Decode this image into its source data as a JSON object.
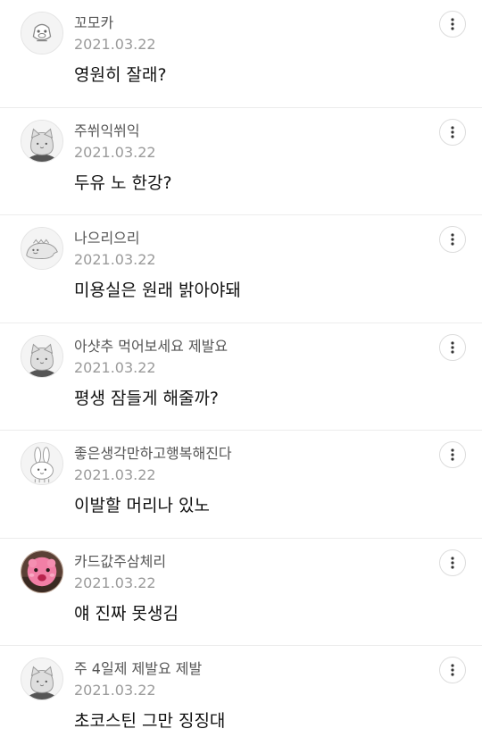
{
  "comments": [
    {
      "nickname": "꼬모카",
      "date": "2021.03.22",
      "text": "영원히 잘래?",
      "avatar": "character-egg-icon"
    },
    {
      "nickname": "주쒸익쒸익",
      "date": "2021.03.22",
      "text": "두유 노 한강?",
      "avatar": "cat-face-icon"
    },
    {
      "nickname": "나으리으리",
      "date": "2021.03.22",
      "text": "미용실은 원래 밝아야돼",
      "avatar": "dinosaur-icon"
    },
    {
      "nickname": "아샷추 먹어보세요 제발요",
      "date": "2021.03.22",
      "text": "평생 잠들게 해줄까?",
      "avatar": "cat-face-icon"
    },
    {
      "nickname": "좋은생각만하고행복해진다",
      "date": "2021.03.22",
      "text": "이발할 머리나 있노",
      "avatar": "rabbit-icon"
    },
    {
      "nickname": "카드값주삼체리",
      "date": "2021.03.22",
      "text": "얘 진짜 못생김",
      "avatar": "pink-character-photo"
    },
    {
      "nickname": "주 4일제 제발요 제발",
      "date": "2021.03.22",
      "text": "초코스틴 그만 징징대",
      "avatar": "cat-face-icon"
    }
  ]
}
